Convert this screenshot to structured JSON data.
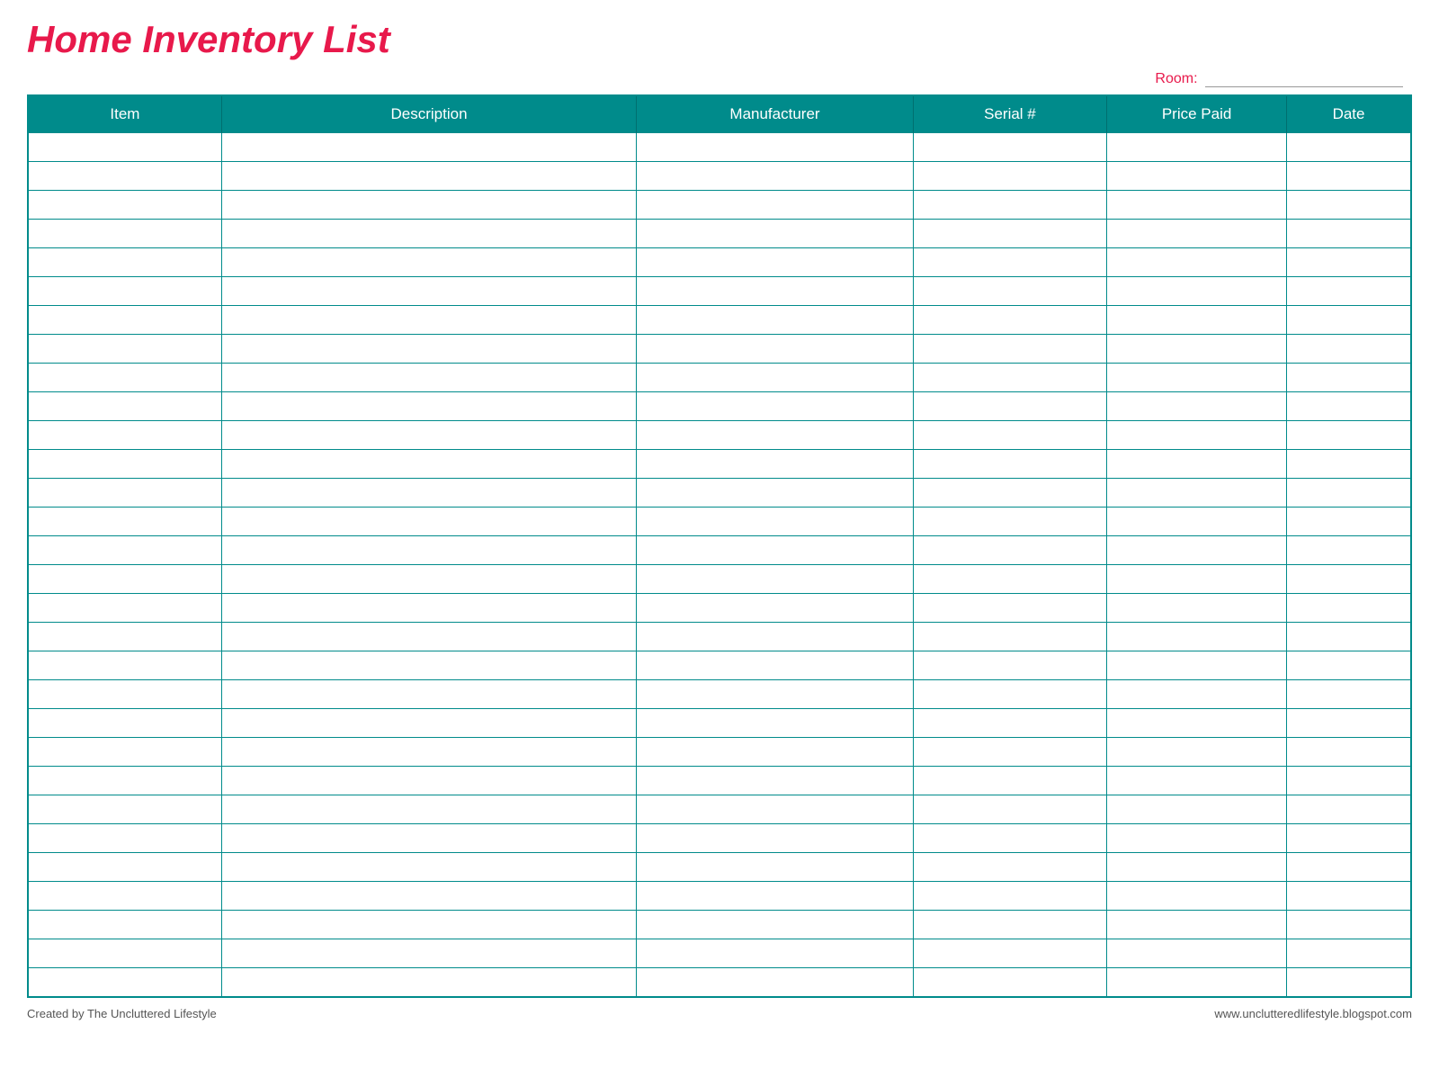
{
  "page": {
    "title": "Home Inventory List",
    "room_label": "Room:",
    "footer_left": "Created by The Uncluttered Lifestyle",
    "footer_right": "www.unclutteredlifestyle.blogspot.com"
  },
  "table": {
    "columns": [
      {
        "label": "Item",
        "class": "col-item"
      },
      {
        "label": "Description",
        "class": "col-description"
      },
      {
        "label": "Manufacturer",
        "class": "col-manufacturer"
      },
      {
        "label": "Serial #",
        "class": "col-serial"
      },
      {
        "label": "Price Paid",
        "class": "col-price"
      },
      {
        "label": "Date",
        "class": "col-date"
      }
    ],
    "row_count": 30
  }
}
